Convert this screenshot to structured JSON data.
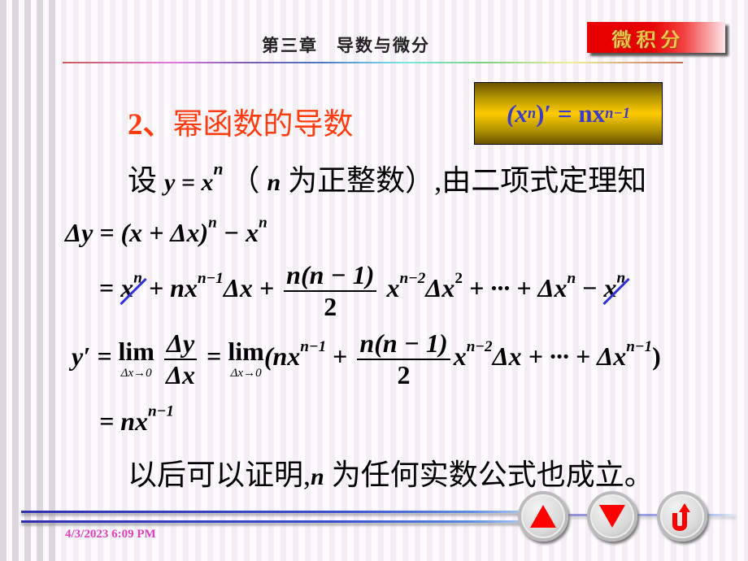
{
  "header": {
    "chapter_title": "第三章　导数与微分",
    "logo_text": "微积分"
  },
  "section": {
    "number": "2、",
    "title": "幂函数的导数"
  },
  "formula_box": {
    "base": "(x",
    "exp": "n",
    "rest": ")′ = nx",
    "exp2": "n−1"
  },
  "intro": {
    "lead": "设 ",
    "eq_y": "y",
    "eq_eq": " = x",
    "eq_exp": "n",
    "paren_open": "（ ",
    "n": "n",
    "middle": " 为正整数）",
    "tail": ",由二项式定理知"
  },
  "derivation": {
    "line1": {
      "lhs": "Δy = (x + Δx)",
      "exp": "n",
      "rest": " − x",
      "exp2": "n"
    },
    "line2": {
      "eq": "= ",
      "x1": "x",
      "x1_exp": "n",
      "t2": " + nx",
      "t2_exp": "n−1",
      "t2b": "Δx + ",
      "frac_num": "n(n − 1)",
      "frac_den": "2",
      "t3": "x",
      "t3_exp": "n−2",
      "t3b": "Δx",
      "t3b_exp": "2",
      "t4": " + ··· + Δx",
      "t4_exp": "n",
      "t5": " − ",
      "x2": "x",
      "x2_exp": "n"
    },
    "line3": {
      "lhs": "y′ = ",
      "lim": "lim",
      "lim_sub": "Δx→0",
      "frac1_num": "Δy",
      "frac1_den": "Δx",
      "eq2": " = ",
      "paren": "(nx",
      "p_exp": "n−1",
      "plus": " + ",
      "frac2_num": "n(n − 1)",
      "frac2_den": "2",
      "t3": "x",
      "t3_exp": "n−2",
      "t3b": "Δx + ··· + Δx",
      "t3b_exp": "n−1",
      "close": ")"
    },
    "line4": {
      "rhs": "= nx",
      "exp": "n−1"
    }
  },
  "closing": {
    "lead": "以后可以证明,",
    "n": "n",
    "tail": " 为任何实数公式也成立。"
  },
  "footer": {
    "date": "4/3/2023 6:09 PM"
  },
  "nav": {
    "prev_icon": "up-triangle-icon",
    "next_icon": "down-triangle-icon",
    "return_icon": "return-arrow-icon",
    "accent_color": "#ff0000"
  },
  "colors": {
    "heading": "#ff3c10",
    "formula_text": "#3c3cc8",
    "date": "#e040c0",
    "strike": "#3232dc"
  }
}
